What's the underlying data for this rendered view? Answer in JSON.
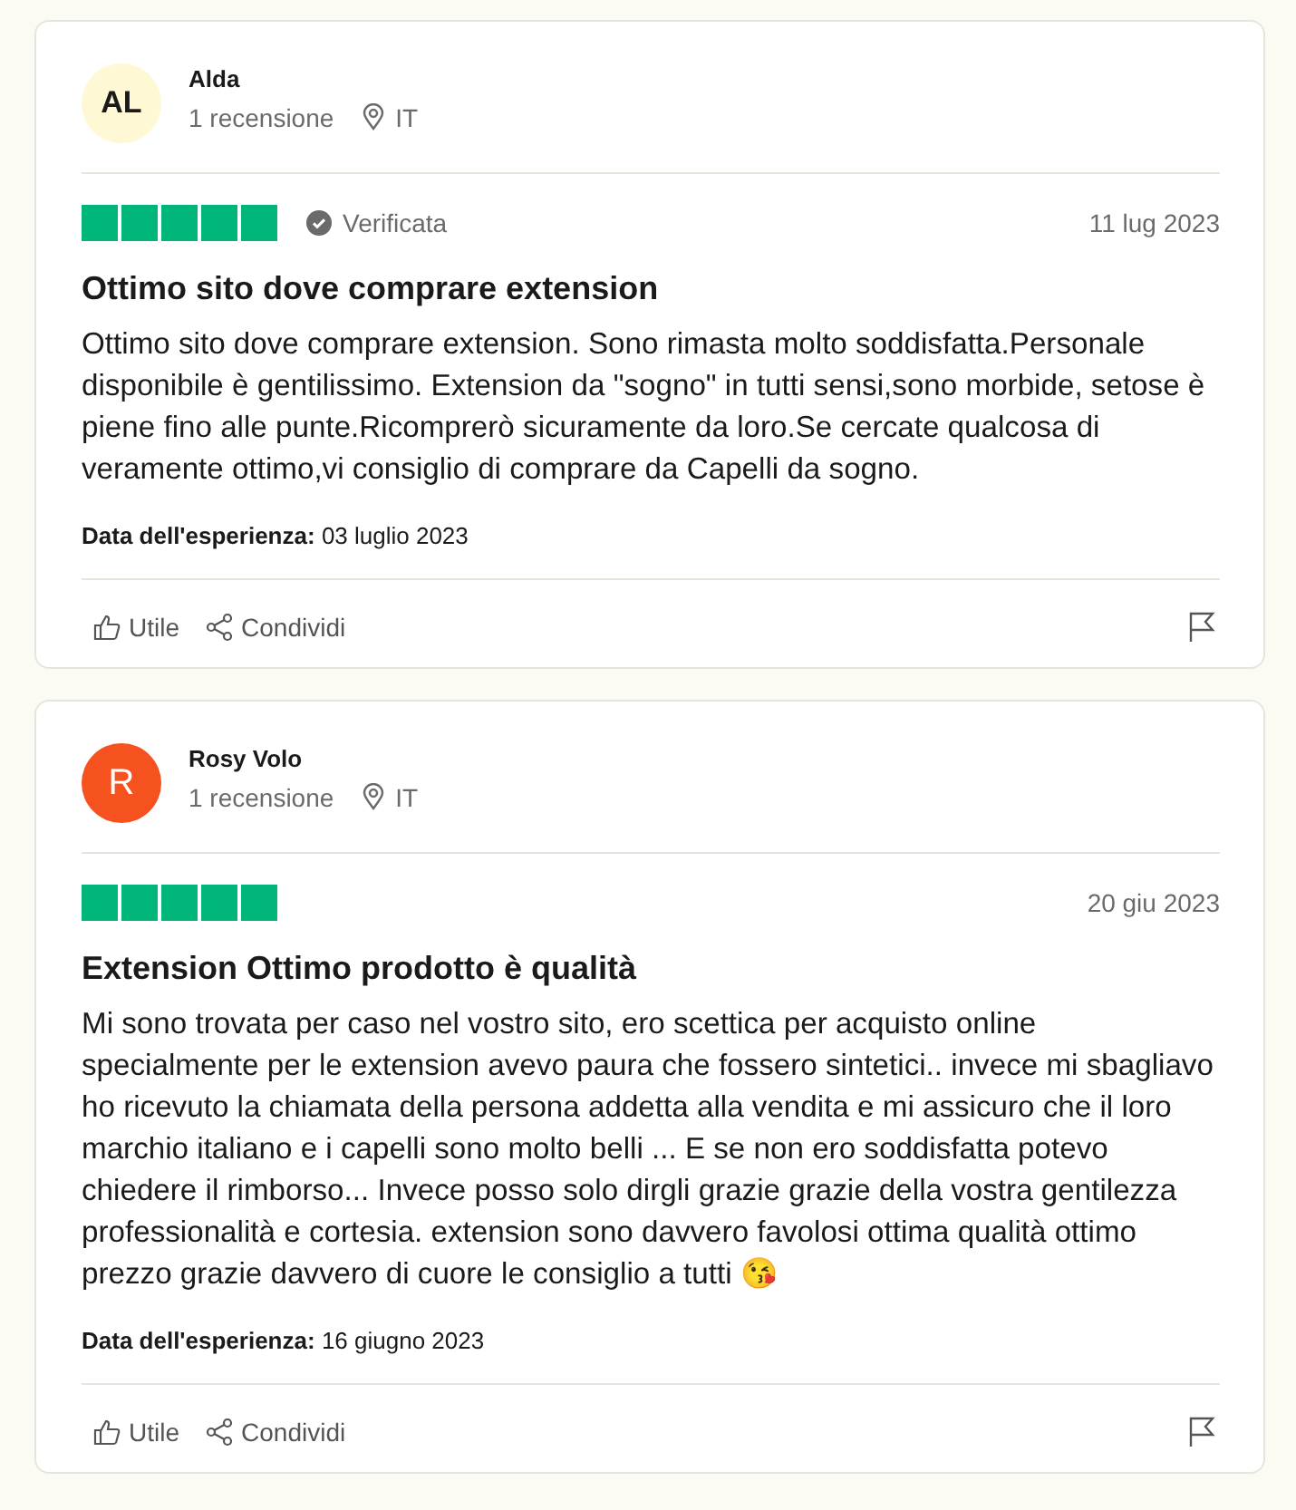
{
  "reviews": [
    {
      "author": "Alda",
      "avatar": {
        "initials": "AL",
        "color": "#fff8d4"
      },
      "review_count": "1 recensione",
      "country": "IT",
      "stars": 5,
      "verified": true,
      "verified_label": "Verificata",
      "date": "11 lug 2023",
      "title": "Ottimo sito dove comprare extension",
      "body": "Ottimo sito dove comprare extension. Sono rimasta molto soddisfatta.Personale disponibile è gentilissimo. Extension da \"sogno\" in tutti sensi,sono morbide, setose è piene fino alle punte.Ricomprerò sicuramente da loro.Se cercate qualcosa di veramente ottimo,vi consiglio di comprare da Capelli da sogno.",
      "experience_label": "Data dell'esperienza:",
      "experience_date": "03 luglio 2023",
      "actions": [
        "Utile",
        "Condividi"
      ]
    },
    {
      "author": "Rosy Volo",
      "avatar": {
        "initials": "R",
        "color": "#f5521f"
      },
      "review_count": "1 recensione",
      "country": "IT",
      "stars": 5,
      "verified": false,
      "date": "20 giu 2023",
      "title": "Extension Ottimo prodotto è qualità",
      "body": "Mi sono trovata per caso nel vostro sito, ero scettica per acquisto online specialmente per le extension avevo paura che fossero sintetici.. invece mi sbagliavo ho ricevuto la chiamata della persona addetta alla vendita e mi assicuro che il loro marchio italiano e i capelli sono molto belli ... E se non ero soddisfatta potevo chiedere il rimborso... Invece posso solo dirgli grazie grazie della vostra gentilezza professionalità e cortesia. extension sono davvero favolosi ottima qualità ottimo prezzo grazie davvero di cuore le consiglio a tutti 😘",
      "experience_label": "Data dell'esperienza:",
      "experience_date": "16 giugno 2023",
      "actions": [
        "Utile",
        "Condividi"
      ]
    }
  ]
}
